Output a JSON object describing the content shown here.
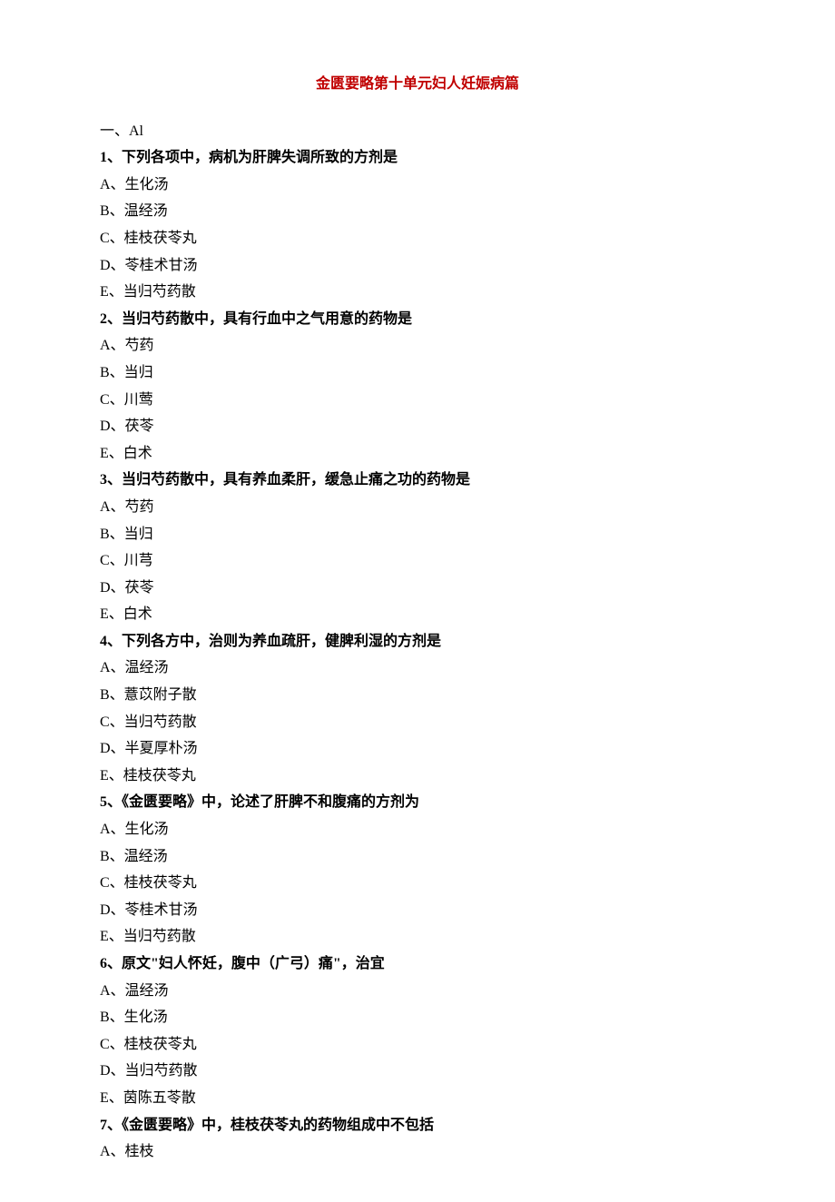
{
  "title": "金匮要略第十单元妇人妊娠病篇",
  "sectionHead": "一、Al",
  "questions": [
    {
      "stem": "1、下列各项中，病机为肝脾失调所致的方剂是",
      "options": [
        "A、生化汤",
        "B、温经汤",
        "C、桂枝茯苓丸",
        "D、苓桂术甘汤",
        "E、当归芍药散"
      ]
    },
    {
      "stem": "2、当归芍药散中，具有行血中之气用意的药物是",
      "options": [
        "A、芍药",
        "B、当归",
        "C、川莺",
        "D、茯苓",
        "E、白术"
      ]
    },
    {
      "stem": "3、当归芍药散中，具有养血柔肝，缓急止痛之功的药物是",
      "options": [
        "A、芍药",
        "B、当归",
        "C、川芎",
        "D、茯苓",
        "E、白术"
      ]
    },
    {
      "stem": "4、下列各方中，治则为养血疏肝，健脾利湿的方剂是",
      "options": [
        "A、温经汤",
        "B、薏苡附子散",
        "C、当归芍药散",
        "D、半夏厚朴汤",
        "E、桂枝茯苓丸"
      ]
    },
    {
      "stem": "5、《金匮要略》中，论述了肝脾不和腹痛的方剂为",
      "options": [
        "A、生化汤",
        "B、温经汤",
        "C、桂枝茯苓丸",
        "D、苓桂术甘汤",
        "E、当归芍药散"
      ]
    },
    {
      "stem": "6、原文\"妇人怀妊，腹中（广弓）痛\"，治宜",
      "options": [
        "A、温经汤",
        "B、生化汤",
        "C、桂枝茯苓丸",
        "D、当归芍药散",
        "E、茵陈五苓散"
      ]
    },
    {
      "stem": "7、《金匮要略》中，桂枝茯苓丸的药物组成中不包括",
      "options": [
        "A、桂枝"
      ]
    }
  ]
}
